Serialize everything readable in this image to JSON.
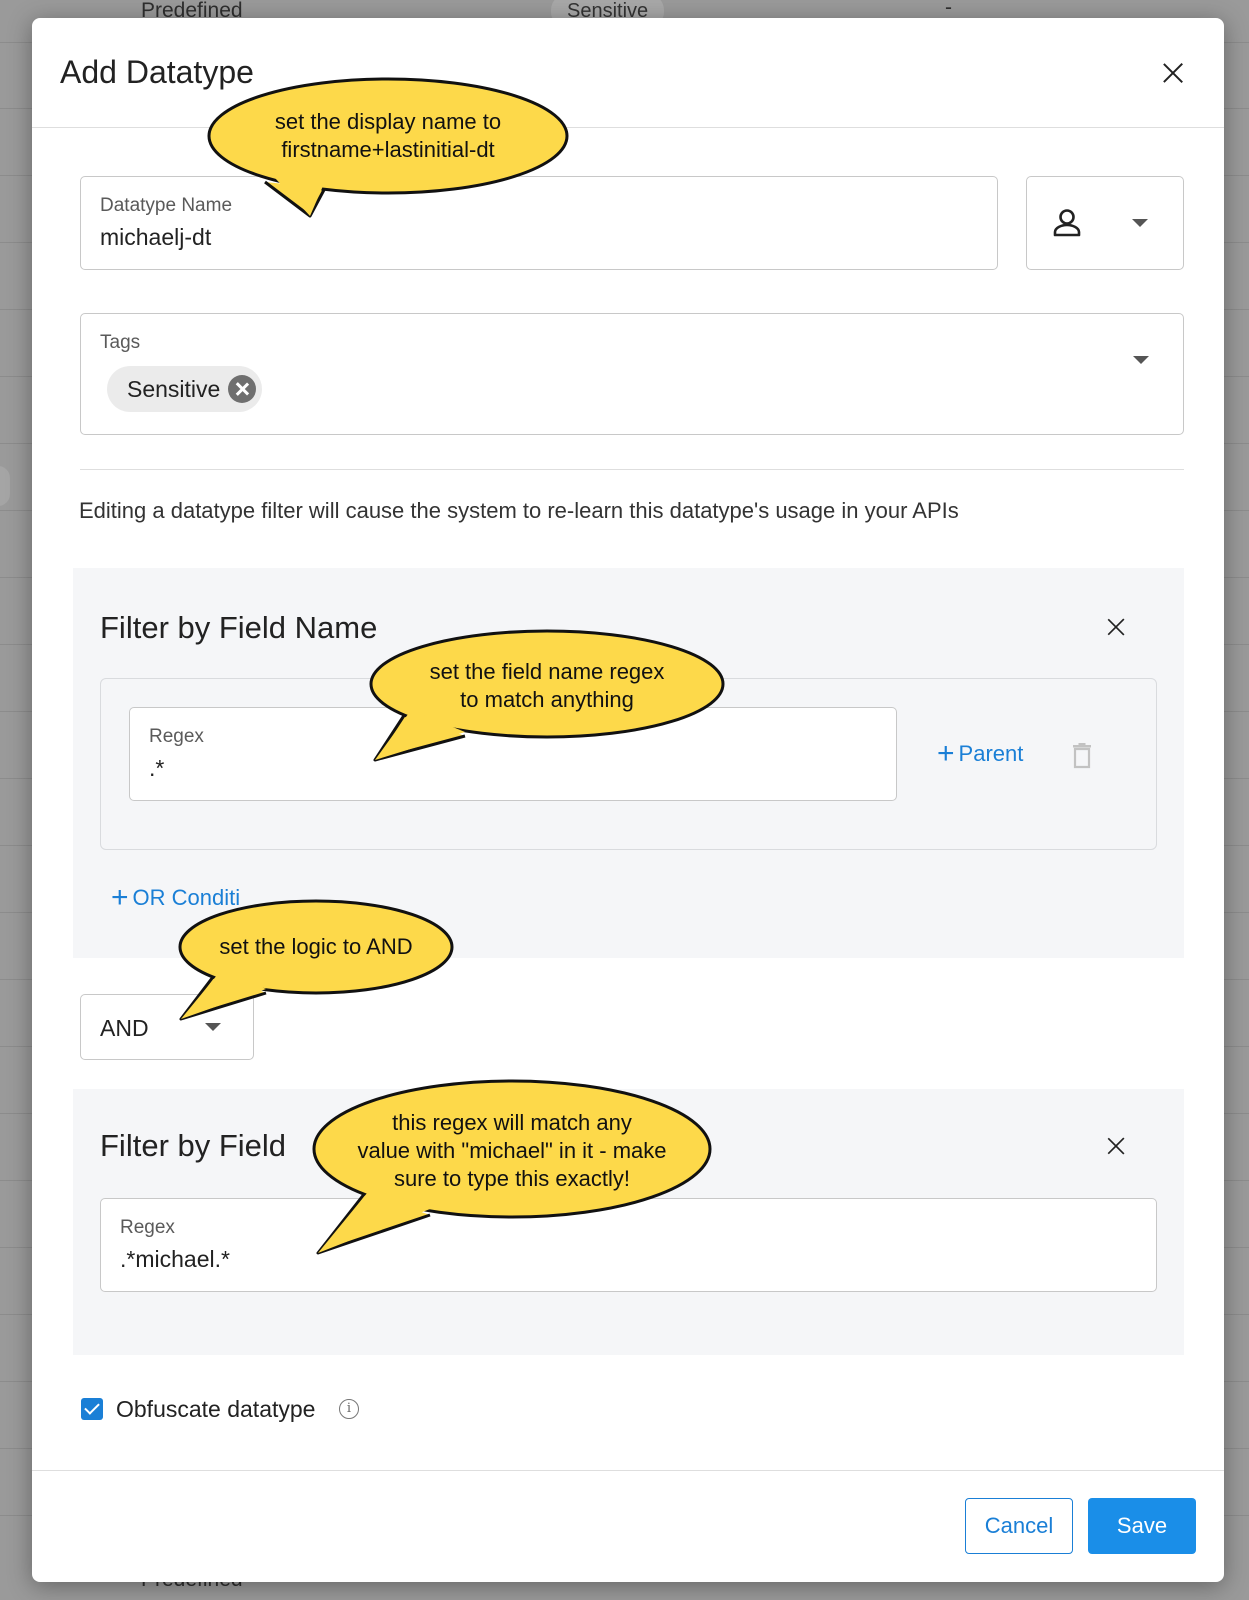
{
  "backdrop": {
    "row_top_type": "Predefined",
    "row_top_tag": "Sensitive",
    "row_top_dash": "-",
    "row_bottom_type": "Predefined"
  },
  "modal": {
    "title": "Add Datatype"
  },
  "datatype_name": {
    "label": "Datatype Name",
    "value": "michaelj-dt"
  },
  "tags": {
    "label": "Tags",
    "chips": [
      "Sensitive"
    ]
  },
  "notice": "Editing a datatype filter will cause the system to re-learn this datatype's usage in your APIs",
  "filter_field_name": {
    "title": "Filter by Field Name",
    "regex_label": "Regex",
    "regex_value": ".*",
    "parent_label": "Parent",
    "or_condition_label": "OR Conditi"
  },
  "logic": {
    "value": "AND"
  },
  "filter_field_value": {
    "title": "Filter by Field",
    "regex_label": "Regex",
    "regex_value": ".*michael.*"
  },
  "obfuscate": {
    "label": "Obfuscate datatype",
    "checked": true,
    "info_glyph": "i"
  },
  "footer": {
    "cancel_label": "Cancel",
    "save_label": "Save"
  },
  "callouts": {
    "display_name": [
      "set the display name to",
      "firstname+lastinitial-dt"
    ],
    "field_regex": [
      "set the field name regex",
      "to match anything"
    ],
    "logic": [
      "set the logic to AND"
    ],
    "value_regex": [
      "this regex will match any",
      "value with \"michael\" in it - make",
      "sure to type this exactly!"
    ]
  },
  "colors": {
    "accent": "#1a7fd6",
    "callout_fill": "#fdd94a",
    "overlay": "#9a9a9a"
  }
}
